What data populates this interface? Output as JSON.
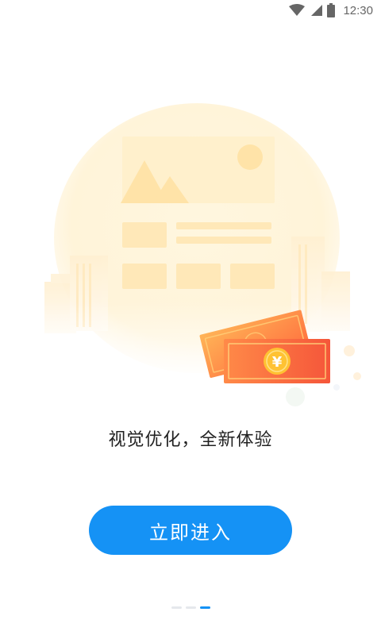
{
  "status_bar": {
    "time": "12:30",
    "icons": [
      "wifi-icon",
      "cellular-signal-icon",
      "battery-icon"
    ]
  },
  "illustration": {
    "icons": [
      "photo-placeholder-icon",
      "red-envelope-cash-icon"
    ],
    "currency_symbol": "¥"
  },
  "slogan": "视觉优化，全新体验",
  "enter_button": {
    "label": "立即进入"
  },
  "pager": {
    "total": 3,
    "current": 3
  },
  "colors": {
    "accent": "#1592f5",
    "text": "#222222",
    "illustration_bg": "#fff6df",
    "cash_red": "#f5563a",
    "cash_orange": "#ffa84f",
    "coin": "#ffc233"
  }
}
